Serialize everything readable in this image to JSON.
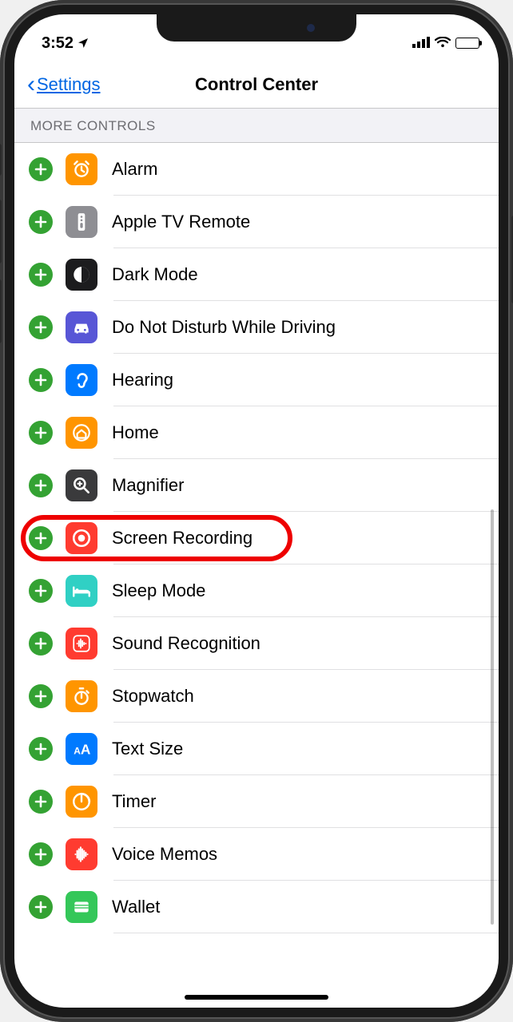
{
  "status": {
    "time": "3:52"
  },
  "nav": {
    "back_label": "Settings",
    "title": "Control Center"
  },
  "section": {
    "title": "MORE CONTROLS"
  },
  "controls": [
    {
      "label": "Alarm",
      "icon": "alarm",
      "bg": "#ff9500"
    },
    {
      "label": "Apple TV Remote",
      "icon": "remote",
      "bg": "#8e8e93"
    },
    {
      "label": "Dark Mode",
      "icon": "darkmode",
      "bg": "#1c1c1e"
    },
    {
      "label": "Do Not Disturb While Driving",
      "icon": "car",
      "bg": "#5856d6"
    },
    {
      "label": "Hearing",
      "icon": "ear",
      "bg": "#007aff"
    },
    {
      "label": "Home",
      "icon": "home",
      "bg": "#ff9500"
    },
    {
      "label": "Magnifier",
      "icon": "magnifier",
      "bg": "#3a3a3c"
    },
    {
      "label": "Screen Recording",
      "icon": "record",
      "bg": "#ff3b30",
      "highlight": true
    },
    {
      "label": "Sleep Mode",
      "icon": "bed",
      "bg": "#30d0c4"
    },
    {
      "label": "Sound Recognition",
      "icon": "sound",
      "bg": "#ff3b30"
    },
    {
      "label": "Stopwatch",
      "icon": "stopwatch",
      "bg": "#ff9500"
    },
    {
      "label": "Text Size",
      "icon": "textsize",
      "bg": "#007aff"
    },
    {
      "label": "Timer",
      "icon": "timer",
      "bg": "#ff9500"
    },
    {
      "label": "Voice Memos",
      "icon": "voice",
      "bg": "#ff3b30"
    },
    {
      "label": "Wallet",
      "icon": "wallet",
      "bg": "#34c759"
    }
  ]
}
